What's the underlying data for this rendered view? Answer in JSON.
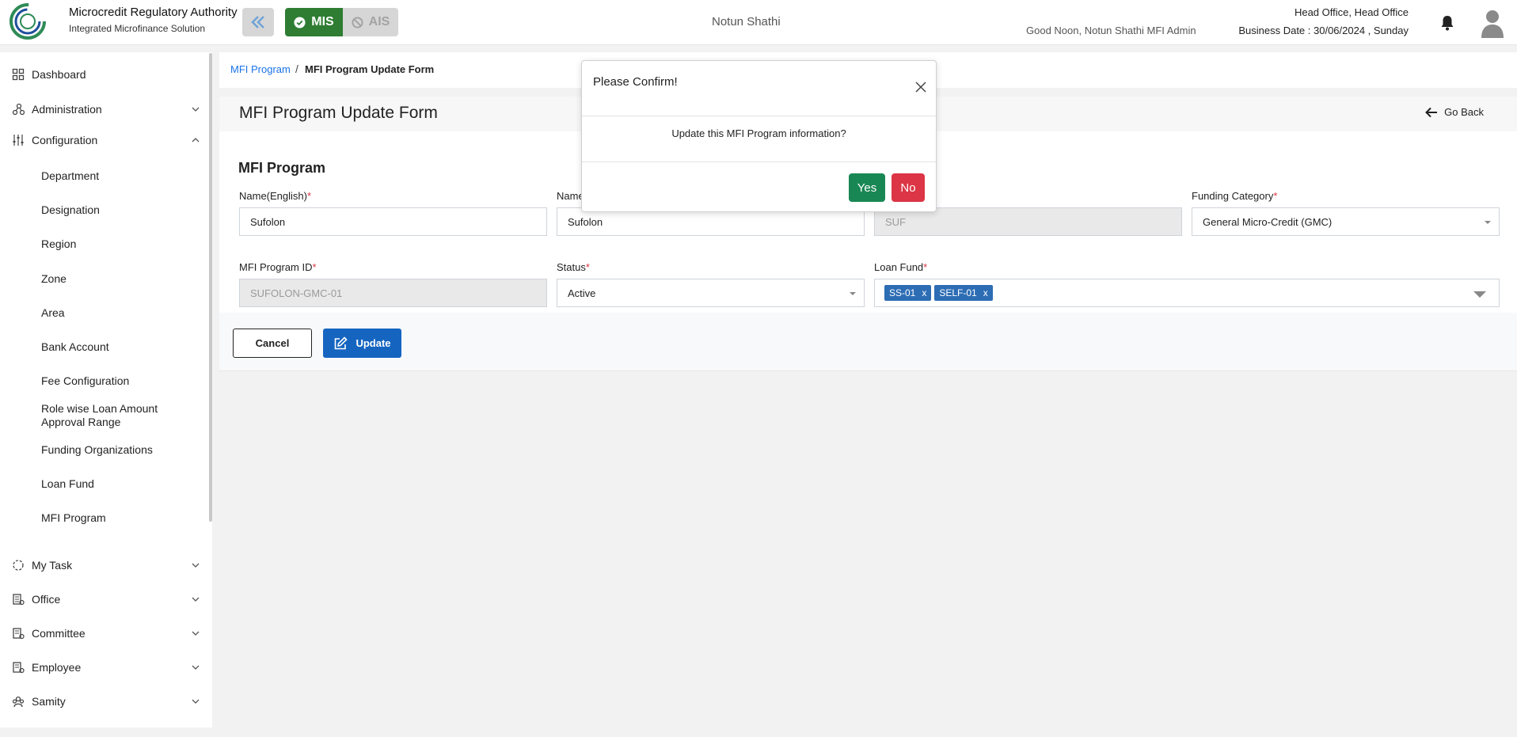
{
  "header": {
    "brand_title": "Microcredit Regulatory Authority",
    "brand_subtitle": "Integrated Microfinance Solution",
    "switch_mis": "MIS",
    "switch_ais": "AIS",
    "org_name": "Notun Shathi",
    "greeting": "Good Noon, Notun Shathi MFI Admin",
    "office": "Head Office, Head Office",
    "business_date": "Business Date : 30/06/2024 , Sunday"
  },
  "sidebar": {
    "dashboard": "Dashboard",
    "administration": "Administration",
    "configuration": "Configuration",
    "config_items": [
      "Department",
      "Designation",
      "Region",
      "Zone",
      "Area",
      "Bank Account",
      "Fee Configuration",
      "Role wise Loan Amount Approval Range",
      "Funding Organizations",
      "Loan Fund",
      "MFI Program"
    ],
    "my_task": "My Task",
    "office": "Office",
    "committee": "Committee",
    "employee": "Employee",
    "samity": "Samity"
  },
  "breadcrumb": {
    "parent": "MFI Program",
    "separator": "/",
    "current": "MFI Program Update Form"
  },
  "page": {
    "title": "MFI Program Update Form",
    "go_back": "Go Back",
    "section_title": "MFI Program"
  },
  "form": {
    "name_english_label": "Name(English)",
    "name_english_value": "Sufolon",
    "name_bangla_label": "Name",
    "name_bangla_value": "Sufolon",
    "short_name_value": "SUF",
    "funding_category_label": "Funding Category",
    "funding_category_value": "General Micro-Credit (GMC)",
    "program_id_label": "MFI Program ID",
    "program_id_value": "SUFOLON-GMC-01",
    "status_label": "Status",
    "status_value": "Active",
    "loan_fund_label": "Loan Fund",
    "loan_fund_tags": [
      "SS-01",
      "SELF-01"
    ],
    "required_mark": "*",
    "tag_remove": "x"
  },
  "actions": {
    "cancel": "Cancel",
    "update": "Update"
  },
  "modal": {
    "title": "Please Confirm!",
    "message": "Update this MFI Program information?",
    "yes": "Yes",
    "no": "No"
  },
  "colors": {
    "mis_green": "#2e7d32",
    "update_blue": "#1565c0",
    "yes_green": "#198754",
    "no_red": "#dc3545",
    "tag_blue": "#2d6db4",
    "link_blue": "#1a73e8"
  }
}
